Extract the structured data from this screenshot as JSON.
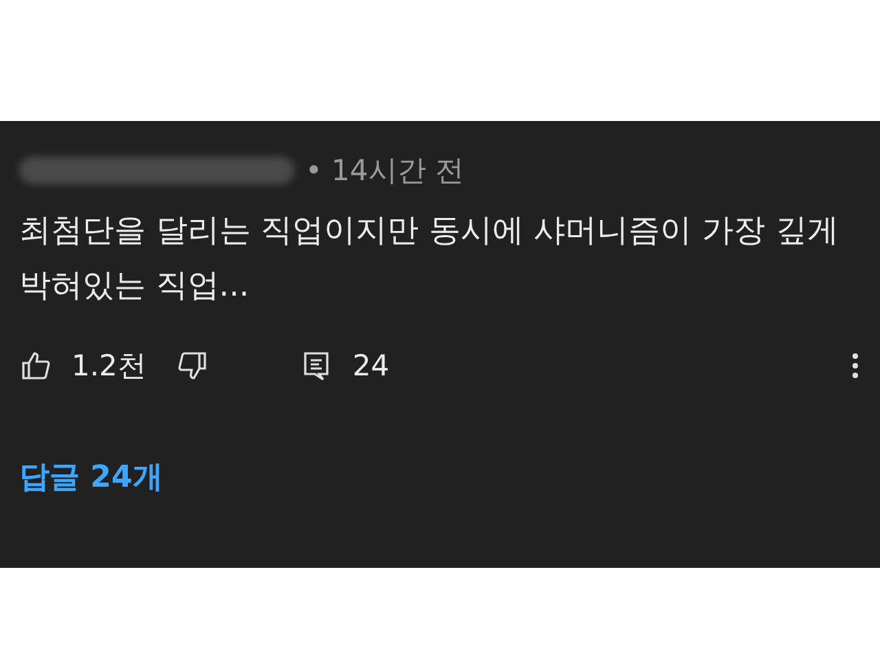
{
  "comment": {
    "time": "• 14시간 전",
    "text": "최첨단을 달리는 직업이지만 동시에 샤머니즘이 가장 깊게 박혀있는 직업...",
    "likes": "1.2천",
    "reply_count": "24",
    "replies_link": "답글 24개"
  }
}
